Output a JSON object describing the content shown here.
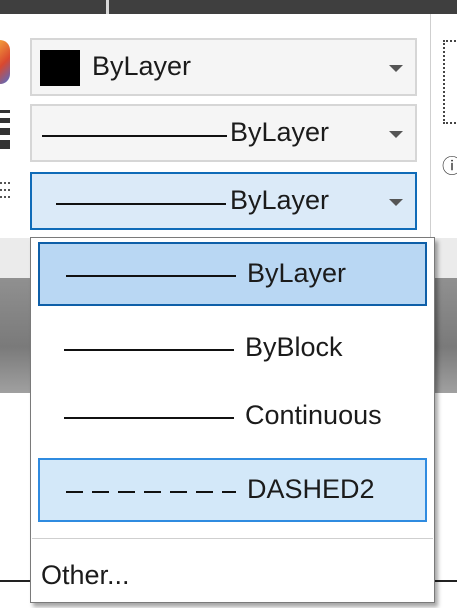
{
  "toolbar": {
    "color_combo": {
      "value": "ByLayer",
      "swatch_color": "#000000"
    },
    "lineweight_combo": {
      "value": "ByLayer"
    },
    "linetype_combo": {
      "value": "ByLayer"
    }
  },
  "dropdown": {
    "items": [
      {
        "label": "ByLayer",
        "state": "selected",
        "style": "solid"
      },
      {
        "label": "ByBlock",
        "state": "normal",
        "style": "solid"
      },
      {
        "label": "Continuous",
        "state": "normal",
        "style": "solid"
      },
      {
        "label": "DASHED2",
        "state": "hover",
        "style": "dashed"
      }
    ],
    "other_label": "Other..."
  },
  "colors": {
    "accent": "#0e5fa8",
    "selected_bg": "#b9d7f3",
    "hover_bg": "#d3e8f9"
  }
}
